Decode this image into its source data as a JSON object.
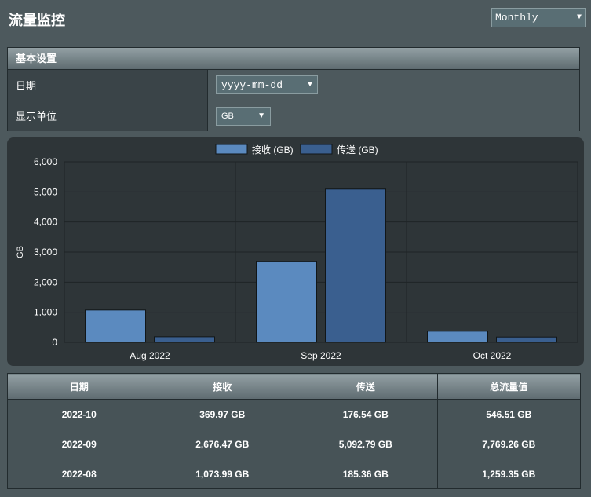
{
  "header": {
    "title": "流量监控",
    "mode": "Monthly"
  },
  "settings": {
    "section_title": "基本设置",
    "rows": [
      {
        "label": "日期",
        "value": "yyyy-mm-dd"
      },
      {
        "label": "显示单位",
        "value": "GB"
      }
    ]
  },
  "chart_data": {
    "type": "bar",
    "categories": [
      "Aug 2022",
      "Sep 2022",
      "Oct 2022"
    ],
    "series": [
      {
        "name": "接收 (GB)",
        "values": [
          1073.99,
          2676.47,
          369.97
        ],
        "color": "#5b8abf"
      },
      {
        "name": "传送 (GB)",
        "values": [
          185.36,
          5092.79,
          176.54
        ],
        "color": "#3a5f8f"
      }
    ],
    "ylabel": "GB",
    "yticks": [
      "0",
      "1,000",
      "2,000",
      "3,000",
      "4,000",
      "5,000",
      "6,000"
    ],
    "ylim": [
      0,
      6000
    ],
    "grid": true,
    "legend": "top-center"
  },
  "table": {
    "headers": [
      "日期",
      "接收",
      "传送",
      "总流量值"
    ],
    "rows": [
      [
        "2022-10",
        "369.97 GB",
        "176.54 GB",
        "546.51 GB"
      ],
      [
        "2022-09",
        "2,676.47 GB",
        "5,092.79 GB",
        "7,769.26 GB"
      ],
      [
        "2022-08",
        "1,073.99 GB",
        "185.36 GB",
        "1,259.35 GB"
      ]
    ]
  },
  "colors": {
    "background": "#4d595d",
    "chart_bg": "#2e3538"
  }
}
